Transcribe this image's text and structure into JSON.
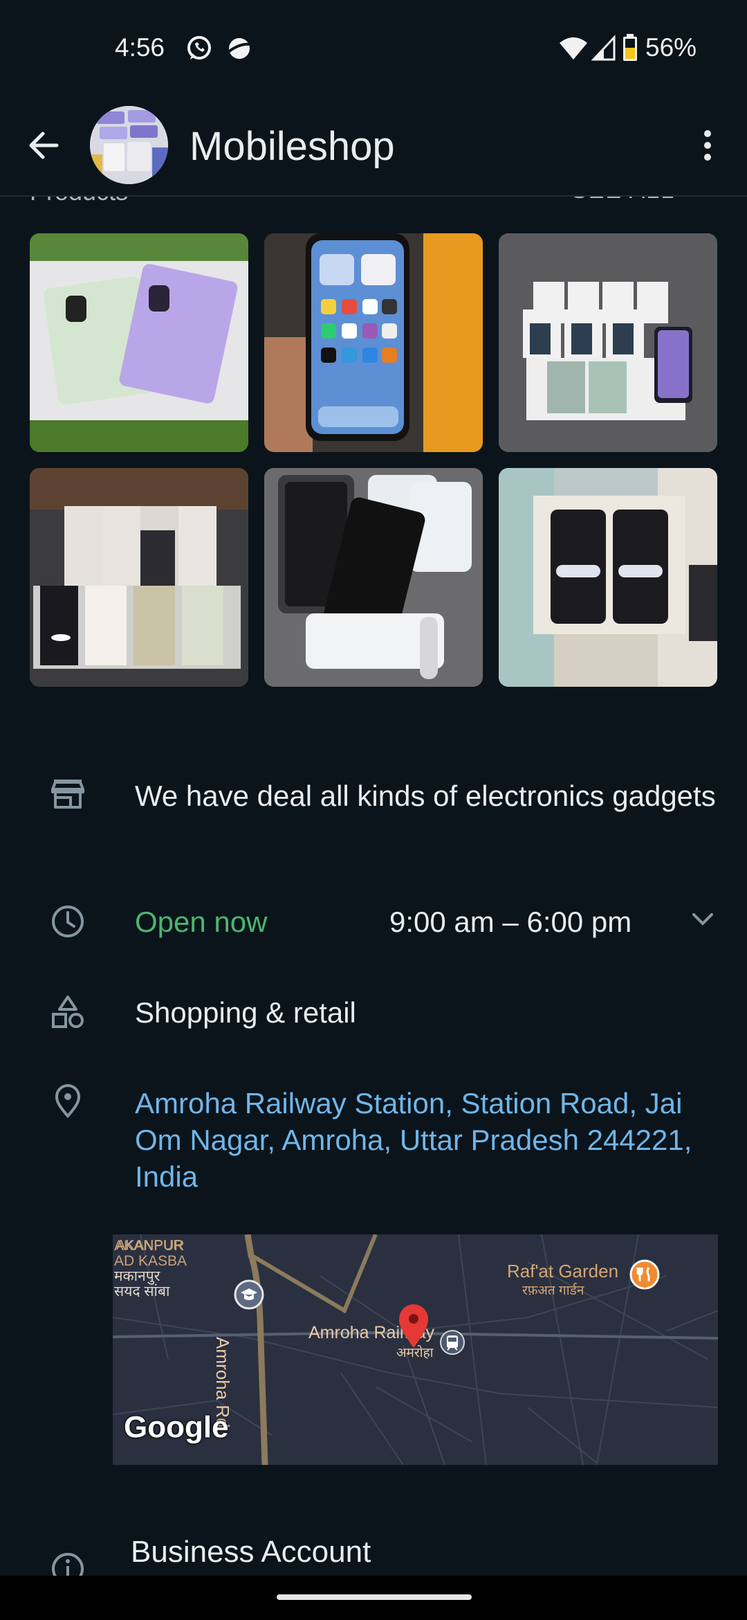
{
  "status_bar": {
    "time": "4:56",
    "battery_percent": "56%",
    "notification_icons": [
      "whatsapp-icon",
      "planet-icon"
    ],
    "system_icons": [
      "wifi-icon",
      "signal-icon",
      "battery-icon"
    ]
  },
  "header": {
    "title": "Mobileshop",
    "back_icon": "arrow-left-icon",
    "menu_icon": "more-vertical-icon"
  },
  "products": {
    "section_title": "Products",
    "see_all_label": "SEE ALL",
    "items": [
      {
        "description": "iPhone green and purple"
      },
      {
        "description": "iPhone home screen"
      },
      {
        "description": "Pixel boxes"
      },
      {
        "description": "Pixel Pro boxes"
      },
      {
        "description": "Pixel 7 phones"
      },
      {
        "description": "Pixel phones in boxes"
      }
    ]
  },
  "info": {
    "description": "We have deal all kinds of electronics gadgets",
    "hours_status": "Open now",
    "hours_range": "9:00 am – 6:00 pm",
    "category": "Shopping & retail",
    "address": "Amroha Railway Station, Station Road, Jai Om Nagar, Amroha, Uttar Pradesh 244221, India"
  },
  "map": {
    "labels": {
      "area_en_1": "AKANPUR",
      "area_en_2": "AD KASBA",
      "area_hi_1": "मकानपुर",
      "area_hi_2": "सयद सांबा",
      "garden_en": "Raf'at Garden",
      "garden_hi": "रफ़अत गार्डन",
      "station_en": "Amroha Railway",
      "station_hi": "अमरोहा",
      "road": "Amroha Rd",
      "brand": "Google"
    },
    "colors": {
      "background": "#2a3040",
      "road": "#8c7a5c",
      "pin": "#e53935",
      "poi": "#f28b2d"
    }
  },
  "business": {
    "label": "Business Account"
  },
  "colors": {
    "background": "#0b141b",
    "text": "#e9edef",
    "open_green": "#4cb56f",
    "link_blue": "#6fb6e9",
    "icon_gray": "#8696a0"
  }
}
